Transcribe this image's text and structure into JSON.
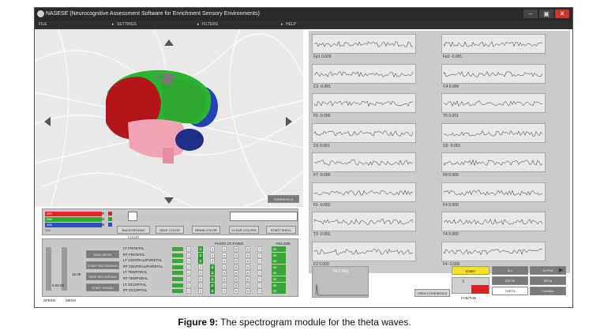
{
  "window": {
    "title": "NASESE (Neurocognitive Assessment Software for Enrichment Sensory Environments)",
    "controls": [
      "–",
      "▣",
      "✕"
    ]
  },
  "menu": [
    {
      "label": "FILE"
    },
    {
      "label": "SETTINGS"
    },
    {
      "label": "FILTERS"
    },
    {
      "label": "HELP"
    }
  ],
  "viewer": {
    "threshold_label": "THRESHOLD"
  },
  "color_panel": {
    "rows": [
      {
        "value": "255",
        "letter": "R",
        "color": "#e02626"
      },
      {
        "value": "255",
        "letter": "G",
        "color": "#2ea82e"
      },
      {
        "value": "255",
        "letter": "B",
        "color": "#2a4fc8"
      }
    ],
    "fourth_value": "255",
    "buttons": [
      "BACKGROUND COLOR",
      "SAVE COLOR",
      "BRAIN COLOR",
      "CLEAR COLORS",
      "START SHELL"
    ]
  },
  "sound_panel": {
    "speed_label": "SPEED",
    "mesh_label": "MESH",
    "value_1": "0.00.00",
    "value_2": "15.00",
    "buttons": [
      "SAVE MESH",
      "START RECORDING",
      "SAVE RECORDING",
      "START SOUND"
    ],
    "piano_label": "PIANO OCTAVES",
    "volume_label": "VOLUME",
    "regions": [
      "LT FRONTAL",
      "RT FRONTAL",
      "LT CENTRAL/PARIETAL",
      "RT CENTRAL/PARIETAL",
      "LT TEMPORAL",
      "RT TEMPORAL",
      "LT OCCIPITAL",
      "RT OCCIPITAL"
    ],
    "octaves": [
      "1",
      "2",
      "3",
      "4",
      "5",
      "6",
      "7"
    ],
    "active_octave": [
      2,
      2,
      2,
      3,
      3,
      3,
      3,
      3
    ],
    "volumes": [
      "50",
      "50",
      "50",
      "50",
      "50",
      "50",
      "50",
      "50"
    ]
  },
  "eeg": {
    "channels_left": [
      {
        "name": "Fp1",
        "value": "0.000"
      },
      {
        "name": "C3",
        "value": "-0.001"
      },
      {
        "name": "F5",
        "value": "-0.000"
      },
      {
        "name": "O1",
        "value": "0.001"
      },
      {
        "name": "F7",
        "value": "-0.000"
      },
      {
        "name": "F2",
        "value": "-0.001"
      },
      {
        "name": "T3",
        "value": "-0.001"
      },
      {
        "name": "F3",
        "value": "0.000"
      }
    ],
    "channels_right": [
      {
        "name": "Fp2",
        "value": "-0.001"
      },
      {
        "name": "C4",
        "value": "0.000"
      },
      {
        "name": "T6",
        "value": "0.001"
      },
      {
        "name": "O2",
        "value": "-0.001"
      },
      {
        "name": "F8",
        "value": "0.000"
      },
      {
        "name": "F4",
        "value": "0.000"
      },
      {
        "name": "T4",
        "value": "0.000"
      },
      {
        "name": "F4",
        "value": "-0.000"
      }
    ]
  },
  "fft": {
    "label": "FFT Plot",
    "coherence_button": "OPEN COHERENCE",
    "start_button": "START",
    "theta_label": "S",
    "meter_label": "FAB/THD",
    "bands": [
      "ALL",
      "ALPHA",
      "DELTA",
      "BETA",
      "THETA",
      "GAMMA"
    ],
    "selected_band": "THETA",
    "accent": "#f2e020",
    "alert": "#e02020"
  },
  "caption": {
    "prefix": "Figure 9:",
    "text": " The spectrogram module for the theta waves."
  }
}
